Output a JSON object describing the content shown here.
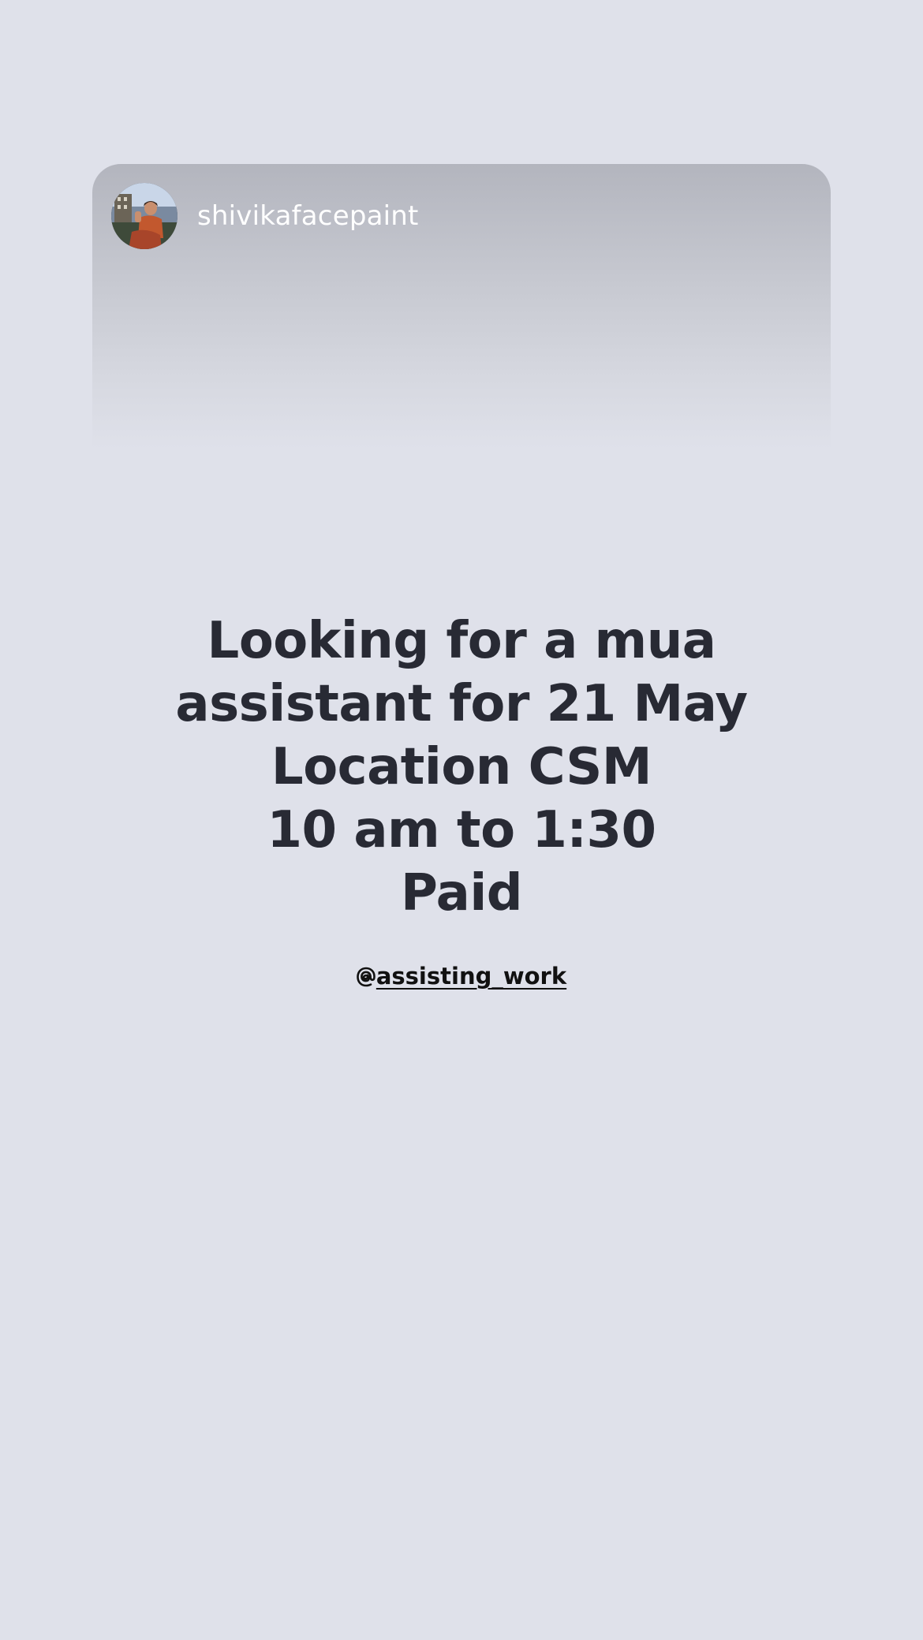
{
  "story": {
    "username": "shivikafacepaint",
    "lines": [
      "Looking for a mua",
      "assistant for 21 May",
      "Location CSM",
      "10 am to 1:30",
      "Paid"
    ],
    "mention": "assisting_work"
  },
  "colors": {
    "background": "#dfe1ea",
    "text": "#282a34",
    "username": "#ffffff"
  },
  "icons": {
    "mention": "threads-at-icon",
    "avatar": "profile-photo"
  }
}
